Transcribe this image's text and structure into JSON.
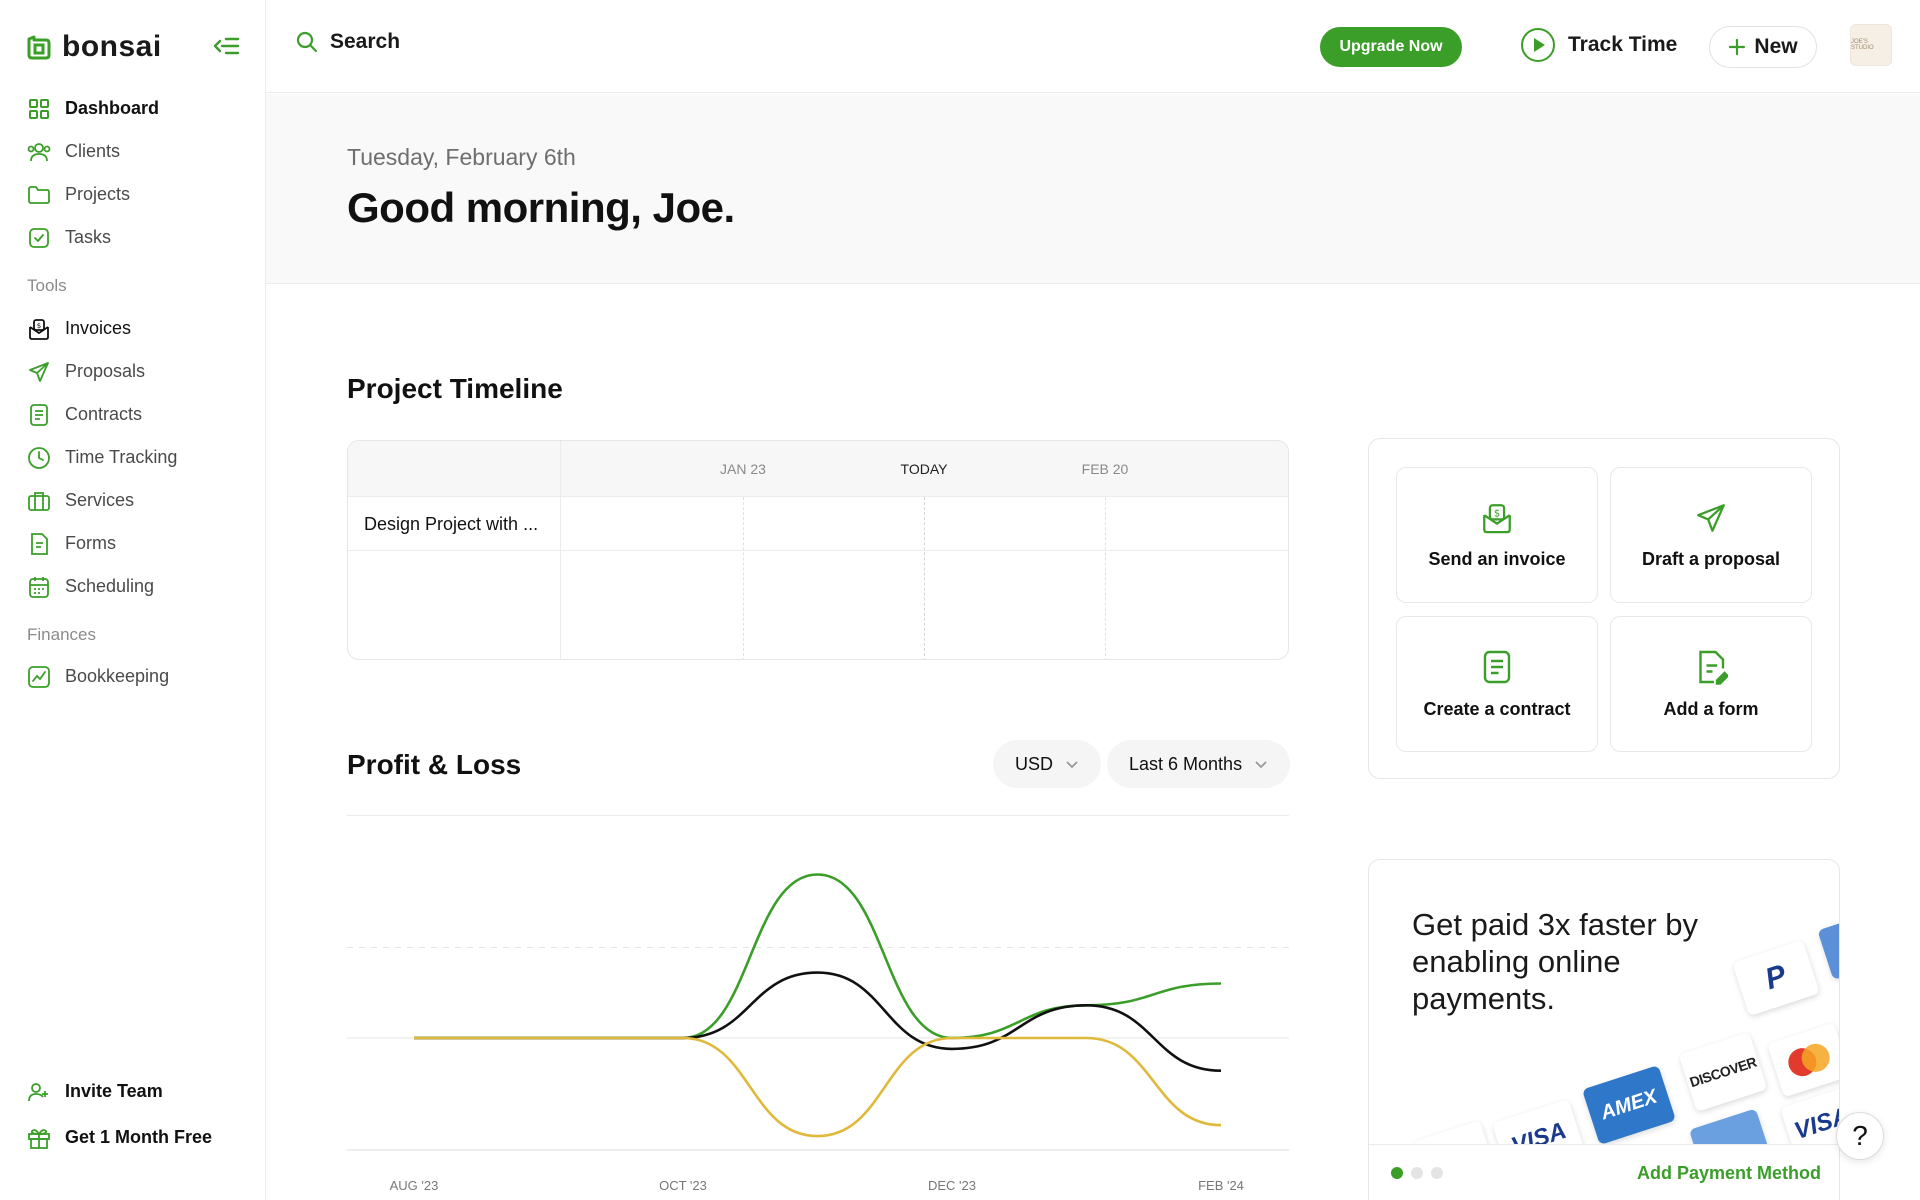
{
  "brand": {
    "name": "bonsai",
    "accent": "#3a9e29"
  },
  "sidebar": {
    "primary": [
      {
        "label": "Dashboard",
        "icon": "grid-icon",
        "active": true
      },
      {
        "label": "Clients",
        "icon": "users-icon"
      },
      {
        "label": "Projects",
        "icon": "folder-icon"
      },
      {
        "label": "Tasks",
        "icon": "checkbox-icon"
      }
    ],
    "tools_label": "Tools",
    "tools": [
      {
        "label": "Invoices",
        "icon": "invoice-icon"
      },
      {
        "label": "Proposals",
        "icon": "send-icon"
      },
      {
        "label": "Contracts",
        "icon": "document-icon"
      },
      {
        "label": "Time Tracking",
        "icon": "clock-icon"
      },
      {
        "label": "Services",
        "icon": "briefcase-icon"
      },
      {
        "label": "Forms",
        "icon": "form-icon"
      },
      {
        "label": "Scheduling",
        "icon": "calendar-icon"
      }
    ],
    "finances_label": "Finances",
    "finances": [
      {
        "label": "Bookkeeping",
        "icon": "chart-icon"
      }
    ],
    "bottom": [
      {
        "label": "Invite Team",
        "icon": "user-plus-icon"
      },
      {
        "label": "Get 1 Month Free",
        "icon": "gift-icon"
      }
    ]
  },
  "topbar": {
    "search_label": "Search",
    "upgrade_label": "Upgrade Now",
    "track_time_label": "Track Time",
    "new_label": "New",
    "avatar_text": "JOE'S STUDIO"
  },
  "header": {
    "date": "Tuesday, February 6th",
    "greeting": "Good morning, Joe."
  },
  "timeline": {
    "title": "Project Timeline",
    "dates": [
      "JAN 23",
      "TODAY",
      "FEB 20"
    ],
    "projects": [
      "Design Project with ..."
    ]
  },
  "profit_loss": {
    "title": "Profit & Loss",
    "currency": "USD",
    "range": "Last 6 Months"
  },
  "chart_data": {
    "type": "line",
    "x": [
      "AUG '23",
      "OCT '23",
      "DEC '23",
      "FEB '24"
    ],
    "series": [
      {
        "color": "#3a9e29",
        "points": [
          [
            0,
            0
          ],
          [
            1,
            0
          ],
          [
            1.5,
            1.5
          ],
          [
            2,
            0
          ],
          [
            2.5,
            0.3
          ],
          [
            3,
            0.5
          ]
        ]
      },
      {
        "color": "#111111",
        "points": [
          [
            0,
            0
          ],
          [
            1,
            0
          ],
          [
            1.5,
            0.6
          ],
          [
            2,
            -0.1
          ],
          [
            2.5,
            0.3
          ],
          [
            3,
            -0.3
          ]
        ]
      },
      {
        "color": "#e0b83a",
        "points": [
          [
            0,
            0
          ],
          [
            1,
            0
          ],
          [
            1.5,
            -0.9
          ],
          [
            2,
            0
          ],
          [
            2.5,
            0
          ],
          [
            3,
            -0.8
          ]
        ]
      }
    ],
    "grid": true
  },
  "quick_actions": [
    {
      "label": "Send an invoice",
      "icon": "invoice-icon"
    },
    {
      "label": "Draft a proposal",
      "icon": "send-icon"
    },
    {
      "label": "Create a contract",
      "icon": "document-icon"
    },
    {
      "label": "Add a form",
      "icon": "form-edit-icon"
    }
  ],
  "promo": {
    "text": "Get paid 3x faster by enabling online payments.",
    "cta": "Add Payment Method",
    "cards": [
      "P",
      "AMEX",
      "DISCOVER",
      "VISA",
      "VISA"
    ]
  }
}
